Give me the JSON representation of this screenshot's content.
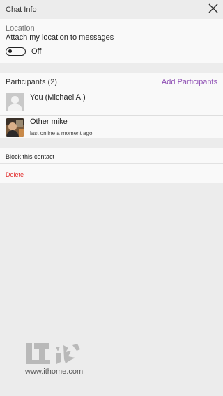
{
  "header": {
    "title": "Chat Info",
    "close_icon": "close-icon"
  },
  "location": {
    "heading": "Location",
    "description": "Attach my location to messages",
    "toggle_state": "Off"
  },
  "participants": {
    "heading": "Participants (2)",
    "add_label": "Add Participants",
    "accent_color": "#8e4fb4",
    "items": [
      {
        "name": "You (Michael A.)",
        "status": ""
      },
      {
        "name": "Other mike",
        "status": "last online a moment ago"
      }
    ]
  },
  "actions": {
    "block_label": "Block this contact",
    "delete_label": "Delete",
    "delete_color": "#e3302f"
  },
  "watermark": {
    "logo_text": "IT之家",
    "url": "www.ithome.com"
  }
}
